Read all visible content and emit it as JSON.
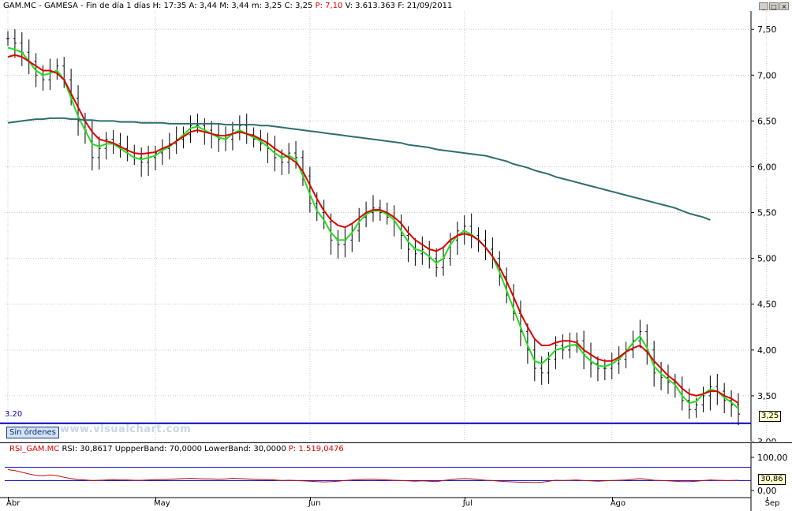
{
  "header": {
    "symbol": "GAM.MC - GAMESA - Fin de día 1 días",
    "values": "H: 17:35  A: 3,44  M: 3,44  m: 3,25  C: 3,25",
    "p_label": "P: 7,10",
    "tail": "V: 3.613.363  F: 21/09/2011"
  },
  "window_buttons": {
    "minimize": "_",
    "maximize": "□",
    "close": "×"
  },
  "price_pane": {
    "last_price_tag": "3,25",
    "horizontal_line_label": "3.20",
    "orders_button": "Sin órdenes",
    "watermark": "www.visualchart.com"
  },
  "rsi_pane": {
    "header_name": "RSI_GAM.MC",
    "header_rest": " RSI: 30,8617  UppperBand: 70,0000  LowerBand: 30,0000  ",
    "header_p": "P: 1.519,0476",
    "last_value_tag": "30,86"
  },
  "colors": {
    "price_bars": "#000000",
    "fast_ma": "#22dd22",
    "slow_ma": "#dd0000",
    "long_ma": "#2e6e6e",
    "support_line": "#0000c0",
    "rsi_line": "#c01010",
    "rsi_bands": "#0000c0"
  },
  "chart_data": [
    {
      "type": "line",
      "title": "GAM.MC - GAMESA",
      "y_ticks": [
        "7,50",
        "7,00",
        "6,50",
        "6,00",
        "5,50",
        "5,00",
        "4,50",
        "4,00",
        "3,50",
        "3,00"
      ],
      "ylim": [
        3.0,
        7.7
      ],
      "x_ticks": [
        "Abr",
        "May",
        "Jun",
        "Jul",
        "Ago",
        "Sep"
      ],
      "x_tick_index": [
        0,
        21,
        43,
        65,
        86,
        108
      ],
      "horizontal_line": 3.2,
      "series": [
        {
          "values": [
            7.4,
            7.35,
            7.25,
            7.15,
            7.0,
            6.95,
            7.05,
            7.1,
            6.95,
            6.75,
            6.5,
            6.4,
            6.1,
            6.2,
            6.3,
            6.25,
            6.2,
            6.15,
            6.1,
            6.05,
            6.1,
            6.15,
            6.2,
            6.25,
            6.3,
            6.35,
            6.45,
            6.45,
            6.4,
            6.35,
            6.3,
            6.3,
            6.4,
            6.45,
            6.35,
            6.3,
            6.25,
            6.2,
            6.1,
            6.05,
            6.15,
            6.1,
            5.9,
            5.6,
            5.5,
            5.4,
            5.2,
            5.15,
            5.2,
            5.3,
            5.45,
            5.5,
            5.55,
            5.5,
            5.45,
            5.4,
            5.25,
            5.1,
            5.05,
            5.1,
            5.0,
            4.9,
            5.0,
            5.2,
            5.3,
            5.35,
            5.25,
            5.2,
            5.1,
            5.0,
            4.8,
            4.6,
            4.4,
            4.2,
            4.0,
            3.8,
            3.75,
            3.9,
            4.05,
            4.0,
            4.05,
            4.1,
            3.95,
            3.85,
            3.8,
            3.8,
            3.85,
            3.9,
            4.0,
            4.1,
            4.2,
            4.0,
            3.75,
            3.7,
            3.65,
            3.6,
            3.45,
            3.35,
            3.4,
            3.5,
            3.6,
            3.55,
            3.45,
            3.4,
            3.3
          ]
        },
        {
          "values": [
            7.3,
            7.28,
            7.25,
            7.15,
            7.05,
            7.0,
            7.02,
            7.05,
            6.95,
            6.75,
            6.55,
            6.4,
            6.25,
            6.22,
            6.25,
            6.25,
            6.2,
            6.15,
            6.1,
            6.08,
            6.1,
            6.12,
            6.18,
            6.22,
            6.28,
            6.35,
            6.42,
            6.44,
            6.4,
            6.36,
            6.32,
            6.3,
            6.36,
            6.4,
            6.36,
            6.32,
            6.28,
            6.22,
            6.15,
            6.1,
            6.12,
            6.08,
            5.9,
            5.7,
            5.52,
            5.42,
            5.28,
            5.2,
            5.2,
            5.28,
            5.4,
            5.48,
            5.52,
            5.52,
            5.48,
            5.42,
            5.3,
            5.18,
            5.1,
            5.08,
            5.02,
            4.95,
            5.0,
            5.15,
            5.25,
            5.3,
            5.26,
            5.2,
            5.12,
            5.02,
            4.85,
            4.65,
            4.45,
            4.25,
            4.05,
            3.88,
            3.85,
            3.92,
            4.0,
            4.02,
            4.05,
            4.06,
            3.95,
            3.88,
            3.83,
            3.82,
            3.85,
            3.9,
            3.98,
            4.08,
            4.15,
            4.02,
            3.82,
            3.74,
            3.68,
            3.62,
            3.5,
            3.42,
            3.44,
            3.52,
            3.57,
            3.55,
            3.48,
            3.43,
            3.36
          ]
        },
        {
          "values": [
            7.2,
            7.22,
            7.2,
            7.15,
            7.1,
            7.05,
            7.05,
            7.02,
            6.95,
            6.8,
            6.65,
            6.5,
            6.38,
            6.3,
            6.28,
            6.26,
            6.22,
            6.18,
            6.15,
            6.14,
            6.15,
            6.16,
            6.2,
            6.23,
            6.28,
            6.33,
            6.38,
            6.4,
            6.38,
            6.36,
            6.34,
            6.34,
            6.36,
            6.38,
            6.36,
            6.34,
            6.3,
            6.26,
            6.2,
            6.15,
            6.1,
            6.05,
            5.95,
            5.8,
            5.65,
            5.52,
            5.42,
            5.36,
            5.34,
            5.38,
            5.44,
            5.5,
            5.53,
            5.53,
            5.5,
            5.45,
            5.38,
            5.28,
            5.2,
            5.15,
            5.1,
            5.08,
            5.12,
            5.2,
            5.25,
            5.27,
            5.25,
            5.2,
            5.12,
            5.02,
            4.9,
            4.75,
            4.58,
            4.4,
            4.25,
            4.12,
            4.05,
            4.05,
            4.08,
            4.1,
            4.1,
            4.08,
            4.0,
            3.95,
            3.9,
            3.88,
            3.88,
            3.92,
            3.98,
            4.02,
            4.05,
            3.98,
            3.88,
            3.8,
            3.72,
            3.66,
            3.58,
            3.52,
            3.5,
            3.52,
            3.55,
            3.55,
            3.5,
            3.47,
            3.42
          ]
        },
        {
          "values": [
            6.48,
            6.49,
            6.5,
            6.51,
            6.52,
            6.52,
            6.53,
            6.53,
            6.53,
            6.52,
            6.52,
            6.51,
            6.51,
            6.5,
            6.5,
            6.5,
            6.49,
            6.49,
            6.49,
            6.48,
            6.48,
            6.48,
            6.48,
            6.47,
            6.47,
            6.47,
            6.47,
            6.47,
            6.47,
            6.47,
            6.47,
            6.46,
            6.46,
            6.46,
            6.46,
            6.46,
            6.45,
            6.45,
            6.44,
            6.43,
            6.42,
            6.41,
            6.4,
            6.39,
            6.38,
            6.37,
            6.36,
            6.35,
            6.34,
            6.33,
            6.32,
            6.31,
            6.3,
            6.29,
            6.28,
            6.27,
            6.26,
            6.24,
            6.23,
            6.22,
            6.21,
            6.19,
            6.18,
            6.17,
            6.16,
            6.15,
            6.14,
            6.13,
            6.12,
            6.1,
            6.08,
            6.06,
            6.03,
            6.01,
            5.99,
            5.96,
            5.94,
            5.92,
            5.89,
            5.87,
            5.85,
            5.83,
            5.81,
            5.79,
            5.77,
            5.75,
            5.73,
            5.71,
            5.69,
            5.67,
            5.65,
            5.63,
            5.61,
            5.59,
            5.57,
            5.55,
            5.52,
            5.49,
            5.47,
            5.45,
            5.42
          ]
        }
      ]
    },
    {
      "type": "line",
      "title": "RSI_GAM.MC",
      "y_ticks": [
        "100,00",
        "0,00"
      ],
      "ylim": [
        0,
        100
      ],
      "bands": [
        70,
        30
      ],
      "series": [
        {
          "values": [
            63,
            60,
            55,
            50,
            46,
            44,
            47,
            45,
            40,
            36,
            33,
            32,
            30,
            31,
            32,
            33,
            32,
            32,
            31,
            31,
            32,
            33,
            33,
            34,
            35,
            36,
            37,
            36,
            35,
            35,
            34,
            35,
            37,
            36,
            35,
            34,
            33,
            33,
            32,
            30,
            31,
            30,
            29,
            28,
            27,
            26,
            27,
            28,
            30,
            32,
            33,
            34,
            34,
            33,
            32,
            31,
            30,
            29,
            28,
            29,
            28,
            27,
            30,
            33,
            35,
            36,
            35,
            33,
            31,
            30,
            28,
            27,
            26,
            25,
            25,
            24,
            25,
            28,
            31,
            30,
            31,
            32,
            30,
            29,
            28,
            29,
            30,
            31,
            32,
            34,
            36,
            34,
            31,
            30,
            29,
            28,
            27,
            27,
            28,
            30,
            32,
            31,
            30,
            30,
            31
          ]
        }
      ]
    }
  ]
}
